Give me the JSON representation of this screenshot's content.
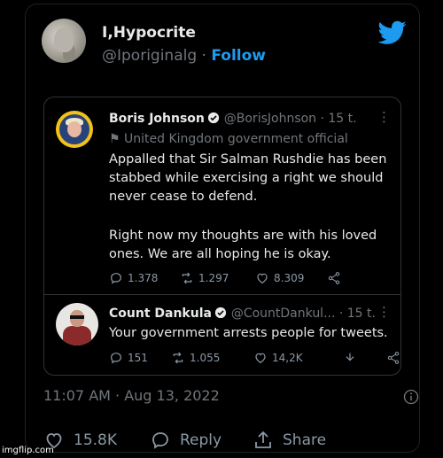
{
  "author": {
    "display_name": "I,Hypocrite",
    "handle": "@Iporiginalg",
    "separator": "·",
    "follow_label": "Follow"
  },
  "icons": {
    "brand": "twitter-bird-icon",
    "brand_color": "#1d9bf0"
  },
  "quoted_thread": {
    "first_tweet": {
      "display_name": "Boris Johnson",
      "handle_time": "@BorisJohnson · 15 t.",
      "label": "United Kingdom government official",
      "text_p1": "Appalled that Sir Salman Rushdie has been stabbed while exercising a right we should never cease to defend.",
      "text_p2": "Right now my thoughts are with his loved ones. We are all hoping he is okay.",
      "replies": "1.378",
      "retweets": "1.297",
      "likes": "8.309"
    },
    "reply_tweet": {
      "display_name": "Count Dankula",
      "handle_time": "@CountDankul... · 15 t.",
      "text": "Your government arrests people for tweets.",
      "replies": "151",
      "retweets": "1.055",
      "likes": "14,2K"
    }
  },
  "timestamp": "11:07 AM · Aug 13, 2022",
  "bottom_bar": {
    "likes": "15.8K",
    "reply_label": "Reply",
    "share_label": "Share"
  },
  "watermark": "imgflip.com"
}
